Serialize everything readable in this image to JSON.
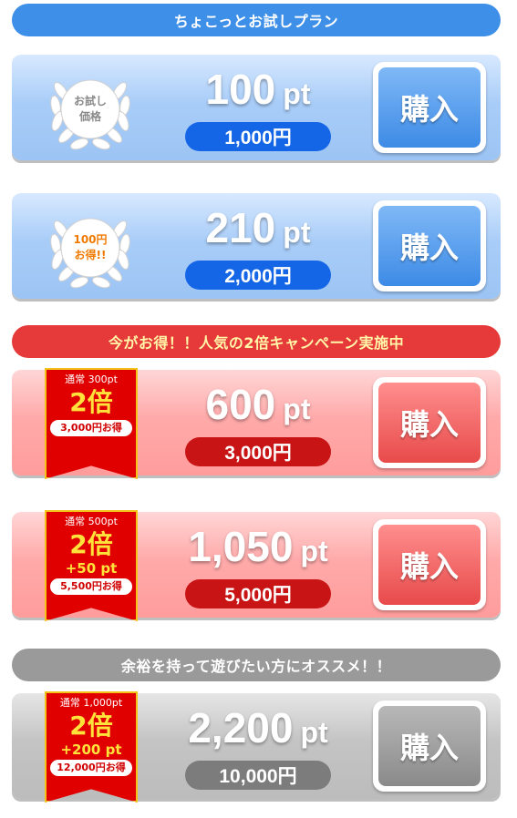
{
  "sections": {
    "trial": "ちょこっとお試しプラン",
    "campaign": "今がお得！！人気の2倍キャンペーン実施中",
    "recommend": "余裕を持って遊びたい方にオススメ！！"
  },
  "buy_label": "購入",
  "unit": "pt",
  "plans": [
    {
      "points": "100",
      "price": "1,000円",
      "badge": {
        "line1": "お試し",
        "line2": "価格"
      }
    },
    {
      "points": "210",
      "price": "2,000円",
      "badge": {
        "line1": "100円",
        "line2": "お得!!"
      }
    },
    {
      "points": "600",
      "price": "3,000円",
      "ribbon": {
        "normal": "通常 300pt",
        "mult": "2倍",
        "save": "3,000円お得"
      }
    },
    {
      "points": "1,050",
      "price": "5,000円",
      "ribbon": {
        "normal": "通常 500pt",
        "mult": "2倍",
        "bonus": "+50 pt",
        "save": "5,500円お得"
      }
    },
    {
      "points": "2,200",
      "price": "10,000円",
      "ribbon": {
        "normal": "通常 1,000pt",
        "mult": "2倍",
        "bonus": "+200 pt",
        "save": "12,000円お得"
      }
    }
  ],
  "colors": {
    "blue_header": "#3d8fe8",
    "red_header": "#e63a3a",
    "gray_header": "#9a9a9a",
    "ribbon_red": "#e00000",
    "ribbon_gold": "#f3c31a"
  }
}
